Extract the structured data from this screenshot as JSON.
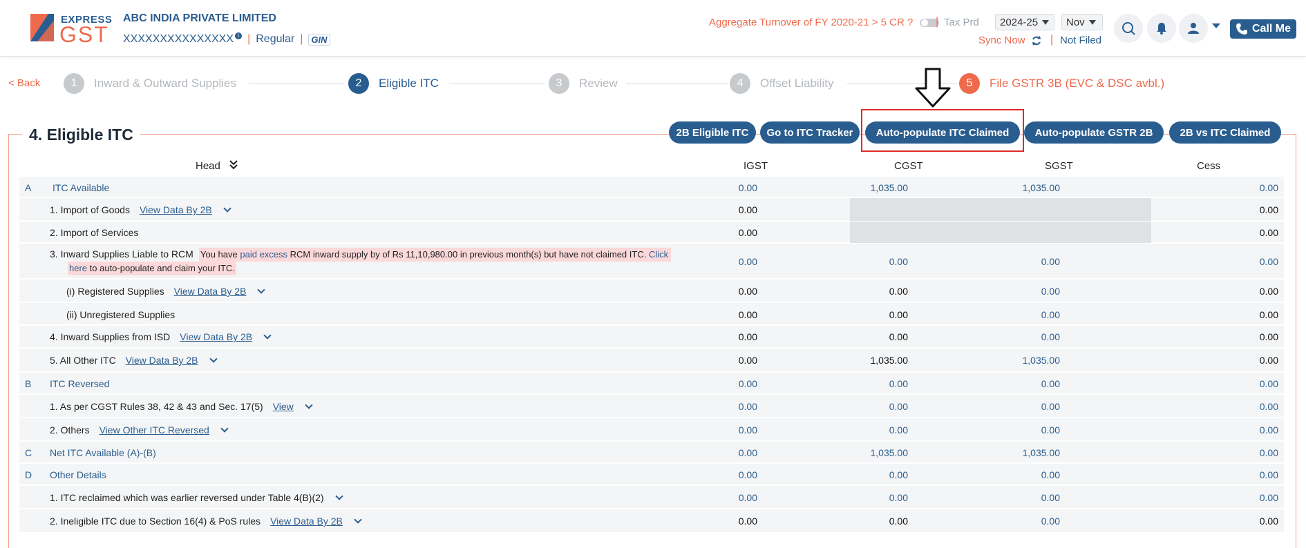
{
  "header": {
    "logo_express": "EXPRESS",
    "logo_gst": "GST",
    "company": "ABC INDIA PRIVATE LIMITED",
    "gstin": "XXXXXXXXXXXXXXX",
    "info_badge": "i",
    "type": "Regular",
    "gin_icon_label": "GIN",
    "turnover_question": "Aggregate Turnover of FY 2020-21 > 5 CR ?",
    "tax_prd_label": "Tax Prd",
    "year": "2024-25",
    "month": "Nov",
    "sync_now": "Sync Now",
    "status": "Not Filed",
    "call_me": "Call Me"
  },
  "stepper": {
    "back": "< Back",
    "steps": [
      {
        "num": "1",
        "label": "Inward & Outward Supplies"
      },
      {
        "num": "2",
        "label": "Eligible ITC"
      },
      {
        "num": "3",
        "label": "Review"
      },
      {
        "num": "4",
        "label": "Offset Liability"
      },
      {
        "num": "5",
        "label": "File GSTR 3B (EVC & DSC avbl.)"
      }
    ]
  },
  "section": {
    "title": "4. Eligible ITC",
    "buttons": [
      "2B Eligible ITC",
      "Go to ITC Tracker",
      "Auto-populate ITC Claimed",
      "Auto-populate GSTR 2B",
      "2B vs ITC Claimed"
    ]
  },
  "table": {
    "columns": {
      "head": "Head",
      "igst": "IGST",
      "cgst": "CGST",
      "sgst": "SGST",
      "cess": "Cess"
    },
    "rcm_note": {
      "p1": "You have",
      "p2": "paid excess",
      "p3": "RCM inward supply by of Rs 11,10,980.00 in previous month(s) but have not claimed ITC.",
      "p4": "Click",
      "p5": "here",
      "p6": "to auto-populate and claim your ITC."
    },
    "rows": [
      {
        "letter": "A",
        "label": "ITC Available",
        "link": "",
        "igst": "0.00",
        "cgst": "1,035.00",
        "sgst": "1,035.00",
        "cess": "0.00"
      },
      {
        "letter": "",
        "label": "1.  Import of Goods",
        "link": "View Data By 2B",
        "igst": "0.00",
        "cgst": "",
        "sgst": "",
        "cess": "0.00"
      },
      {
        "letter": "",
        "label": "2.  Import of Services",
        "link": "",
        "igst": "0.00",
        "cgst": "",
        "sgst": "",
        "cess": "0.00"
      },
      {
        "letter": "",
        "label": "3.  Inward Supplies Liable to RCM",
        "link": "",
        "igst": "0.00",
        "cgst": "0.00",
        "sgst": "0.00",
        "cess": "0.00"
      },
      {
        "letter": "",
        "label": "(i) Registered Supplies",
        "link": "View Data By 2B",
        "igst": "0.00",
        "cgst": "0.00",
        "sgst": "0.00",
        "cess": "0.00"
      },
      {
        "letter": "",
        "label": "(ii) Unregistered Supplies",
        "link": "",
        "igst": "0.00",
        "cgst": "0.00",
        "sgst": "0.00",
        "cess": "0.00"
      },
      {
        "letter": "",
        "label": "4.  Inward Supplies from ISD",
        "link": "View Data By 2B",
        "igst": "0.00",
        "cgst": "0.00",
        "sgst": "0.00",
        "cess": "0.00"
      },
      {
        "letter": "",
        "label": "5.  All Other ITC",
        "link": "View Data By 2B",
        "igst": "0.00",
        "cgst": "1,035.00",
        "sgst": "1,035.00",
        "cess": "0.00"
      },
      {
        "letter": "B",
        "label": "ITC Reversed",
        "link": "",
        "igst": "0.00",
        "cgst": "0.00",
        "sgst": "0.00",
        "cess": "0.00"
      },
      {
        "letter": "",
        "label": "1.  As per CGST Rules 38, 42 & 43 and Sec. 17(5)",
        "link": "View",
        "igst": "0.00",
        "cgst": "0.00",
        "sgst": "0.00",
        "cess": "0.00"
      },
      {
        "letter": "",
        "label": "2.  Others",
        "link": "View Other ITC Reversed",
        "igst": "0.00",
        "cgst": "0.00",
        "sgst": "0.00",
        "cess": "0.00"
      },
      {
        "letter": "C",
        "label": "Net ITC Available (A)-(B)",
        "link": "",
        "igst": "0.00",
        "cgst": "1,035.00",
        "sgst": "1,035.00",
        "cess": "0.00"
      },
      {
        "letter": "D",
        "label": "Other Details",
        "link": "",
        "igst": "0.00",
        "cgst": "0.00",
        "sgst": "0.00",
        "cess": "0.00"
      },
      {
        "letter": "",
        "label": "1. ITC reclaimed which was earlier reversed under Table 4(B)(2)",
        "link": "",
        "igst": "0.00",
        "cgst": "0.00",
        "sgst": "0.00",
        "cess": "0.00"
      },
      {
        "letter": "",
        "label": "2. Ineligible ITC due to Section 16(4) & PoS rules",
        "link": "View Data By 2B",
        "igst": "0.00",
        "cgst": "0.00",
        "sgst": "0.00",
        "cess": "0.00"
      }
    ]
  },
  "colors": {
    "brand_blue": "#2a5d8f",
    "brand_orange": "#ef6a4c",
    "highlight_red": "#e02a2a"
  }
}
